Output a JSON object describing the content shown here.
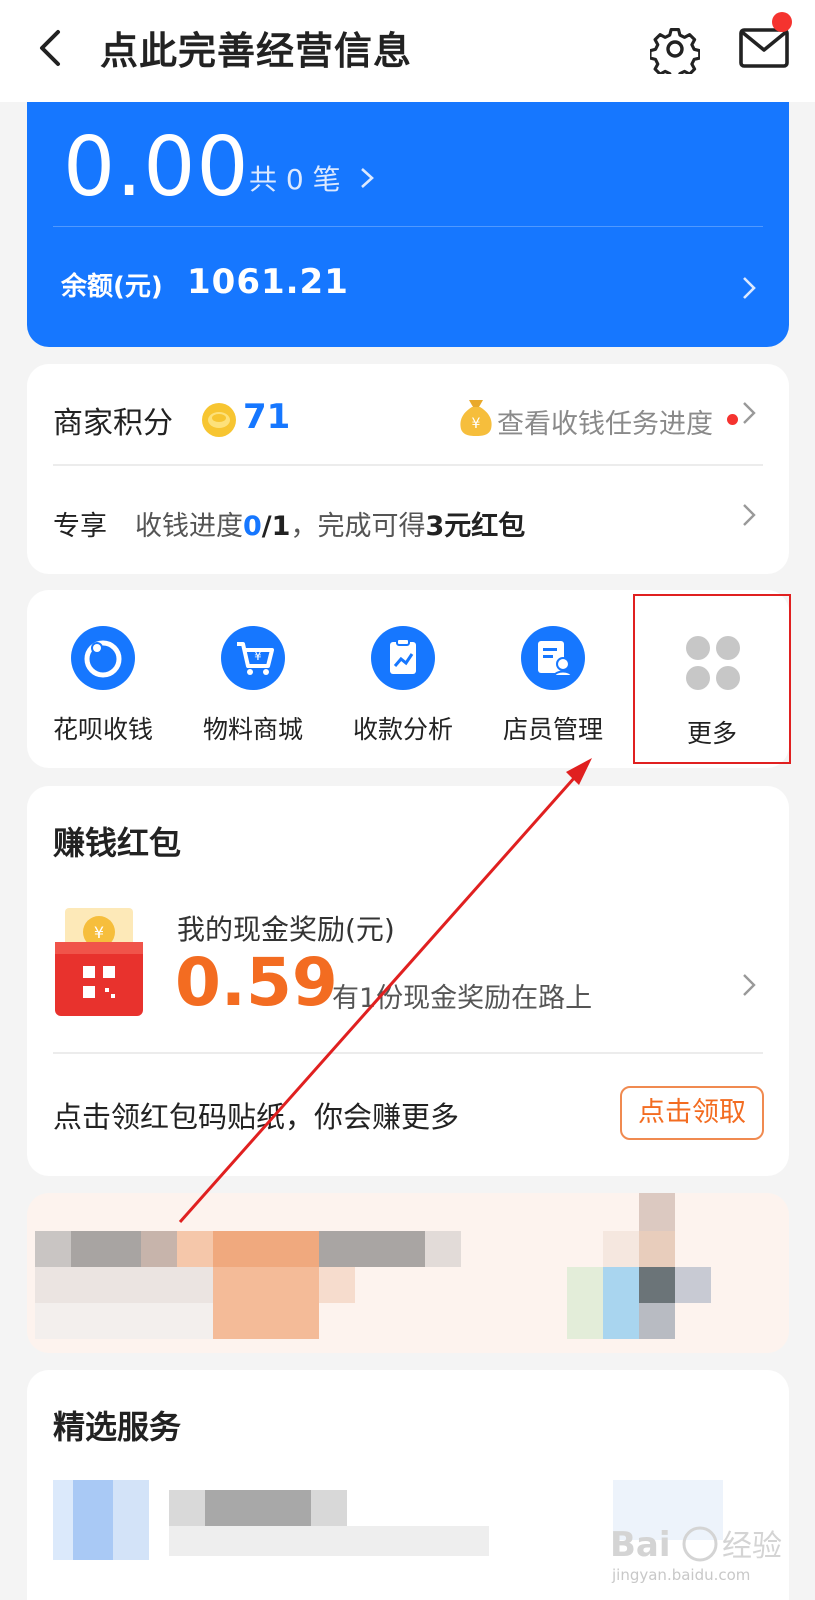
{
  "header": {
    "title": "点此完善经营信息"
  },
  "summary": {
    "amount": "0.00",
    "count_text": "共 0 笔",
    "balance_label": "余额(元)",
    "balance_value": "1061.21"
  },
  "points": {
    "label": "商家积分",
    "value": "71",
    "task_link": "查看收钱任务进度",
    "exclusive_tag": "专享",
    "progress_prefix": "收钱进度",
    "progress_done": "0",
    "progress_total": "/1",
    "progress_suffix": "，完成可得",
    "progress_reward": "3元红包"
  },
  "shortcuts": {
    "items": [
      {
        "label": "花呗收钱"
      },
      {
        "label": "物料商城"
      },
      {
        "label": "收款分析"
      },
      {
        "label": "店员管理"
      }
    ],
    "more_label": "更多"
  },
  "redpack": {
    "title": "赚钱红包",
    "reward_label": "我的现金奖励(元)",
    "reward_value": "0.59",
    "reward_note": "有1份现金奖励在路上",
    "sticker_text": "点击领红包码贴纸，你会赚更多",
    "claim_button": "点击领取"
  },
  "services": {
    "title": "精选服务"
  },
  "watermark": {
    "text": "jingyan.baidu.com"
  },
  "colors": {
    "primary": "#1677ff",
    "accent_orange": "#f36c21",
    "highlight_red": "#e02020"
  },
  "icons": [
    "back-icon",
    "gear-icon",
    "mail-icon",
    "coin-icon",
    "money-bag-icon",
    "huabei-icon",
    "shop-cart-icon",
    "analysis-icon",
    "staff-icon",
    "more-grid-icon",
    "red-envelope-icon"
  ]
}
